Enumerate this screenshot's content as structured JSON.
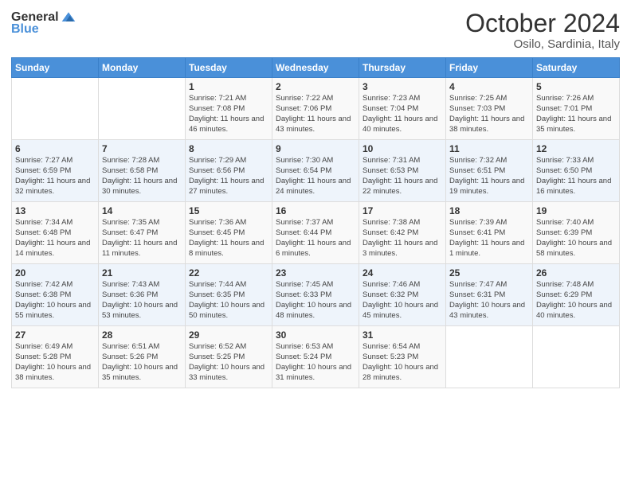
{
  "header": {
    "logo_general": "General",
    "logo_blue": "Blue",
    "month": "October 2024",
    "location": "Osilo, Sardinia, Italy"
  },
  "days_of_week": [
    "Sunday",
    "Monday",
    "Tuesday",
    "Wednesday",
    "Thursday",
    "Friday",
    "Saturday"
  ],
  "weeks": [
    [
      {
        "day": "",
        "content": ""
      },
      {
        "day": "",
        "content": ""
      },
      {
        "day": "1",
        "content": "Sunrise: 7:21 AM\nSunset: 7:08 PM\nDaylight: 11 hours and 46 minutes."
      },
      {
        "day": "2",
        "content": "Sunrise: 7:22 AM\nSunset: 7:06 PM\nDaylight: 11 hours and 43 minutes."
      },
      {
        "day": "3",
        "content": "Sunrise: 7:23 AM\nSunset: 7:04 PM\nDaylight: 11 hours and 40 minutes."
      },
      {
        "day": "4",
        "content": "Sunrise: 7:25 AM\nSunset: 7:03 PM\nDaylight: 11 hours and 38 minutes."
      },
      {
        "day": "5",
        "content": "Sunrise: 7:26 AM\nSunset: 7:01 PM\nDaylight: 11 hours and 35 minutes."
      }
    ],
    [
      {
        "day": "6",
        "content": "Sunrise: 7:27 AM\nSunset: 6:59 PM\nDaylight: 11 hours and 32 minutes."
      },
      {
        "day": "7",
        "content": "Sunrise: 7:28 AM\nSunset: 6:58 PM\nDaylight: 11 hours and 30 minutes."
      },
      {
        "day": "8",
        "content": "Sunrise: 7:29 AM\nSunset: 6:56 PM\nDaylight: 11 hours and 27 minutes."
      },
      {
        "day": "9",
        "content": "Sunrise: 7:30 AM\nSunset: 6:54 PM\nDaylight: 11 hours and 24 minutes."
      },
      {
        "day": "10",
        "content": "Sunrise: 7:31 AM\nSunset: 6:53 PM\nDaylight: 11 hours and 22 minutes."
      },
      {
        "day": "11",
        "content": "Sunrise: 7:32 AM\nSunset: 6:51 PM\nDaylight: 11 hours and 19 minutes."
      },
      {
        "day": "12",
        "content": "Sunrise: 7:33 AM\nSunset: 6:50 PM\nDaylight: 11 hours and 16 minutes."
      }
    ],
    [
      {
        "day": "13",
        "content": "Sunrise: 7:34 AM\nSunset: 6:48 PM\nDaylight: 11 hours and 14 minutes."
      },
      {
        "day": "14",
        "content": "Sunrise: 7:35 AM\nSunset: 6:47 PM\nDaylight: 11 hours and 11 minutes."
      },
      {
        "day": "15",
        "content": "Sunrise: 7:36 AM\nSunset: 6:45 PM\nDaylight: 11 hours and 8 minutes."
      },
      {
        "day": "16",
        "content": "Sunrise: 7:37 AM\nSunset: 6:44 PM\nDaylight: 11 hours and 6 minutes."
      },
      {
        "day": "17",
        "content": "Sunrise: 7:38 AM\nSunset: 6:42 PM\nDaylight: 11 hours and 3 minutes."
      },
      {
        "day": "18",
        "content": "Sunrise: 7:39 AM\nSunset: 6:41 PM\nDaylight: 11 hours and 1 minute."
      },
      {
        "day": "19",
        "content": "Sunrise: 7:40 AM\nSunset: 6:39 PM\nDaylight: 10 hours and 58 minutes."
      }
    ],
    [
      {
        "day": "20",
        "content": "Sunrise: 7:42 AM\nSunset: 6:38 PM\nDaylight: 10 hours and 55 minutes."
      },
      {
        "day": "21",
        "content": "Sunrise: 7:43 AM\nSunset: 6:36 PM\nDaylight: 10 hours and 53 minutes."
      },
      {
        "day": "22",
        "content": "Sunrise: 7:44 AM\nSunset: 6:35 PM\nDaylight: 10 hours and 50 minutes."
      },
      {
        "day": "23",
        "content": "Sunrise: 7:45 AM\nSunset: 6:33 PM\nDaylight: 10 hours and 48 minutes."
      },
      {
        "day": "24",
        "content": "Sunrise: 7:46 AM\nSunset: 6:32 PM\nDaylight: 10 hours and 45 minutes."
      },
      {
        "day": "25",
        "content": "Sunrise: 7:47 AM\nSunset: 6:31 PM\nDaylight: 10 hours and 43 minutes."
      },
      {
        "day": "26",
        "content": "Sunrise: 7:48 AM\nSunset: 6:29 PM\nDaylight: 10 hours and 40 minutes."
      }
    ],
    [
      {
        "day": "27",
        "content": "Sunrise: 6:49 AM\nSunset: 5:28 PM\nDaylight: 10 hours and 38 minutes."
      },
      {
        "day": "28",
        "content": "Sunrise: 6:51 AM\nSunset: 5:26 PM\nDaylight: 10 hours and 35 minutes."
      },
      {
        "day": "29",
        "content": "Sunrise: 6:52 AM\nSunset: 5:25 PM\nDaylight: 10 hours and 33 minutes."
      },
      {
        "day": "30",
        "content": "Sunrise: 6:53 AM\nSunset: 5:24 PM\nDaylight: 10 hours and 31 minutes."
      },
      {
        "day": "31",
        "content": "Sunrise: 6:54 AM\nSunset: 5:23 PM\nDaylight: 10 hours and 28 minutes."
      },
      {
        "day": "",
        "content": ""
      },
      {
        "day": "",
        "content": ""
      }
    ]
  ]
}
